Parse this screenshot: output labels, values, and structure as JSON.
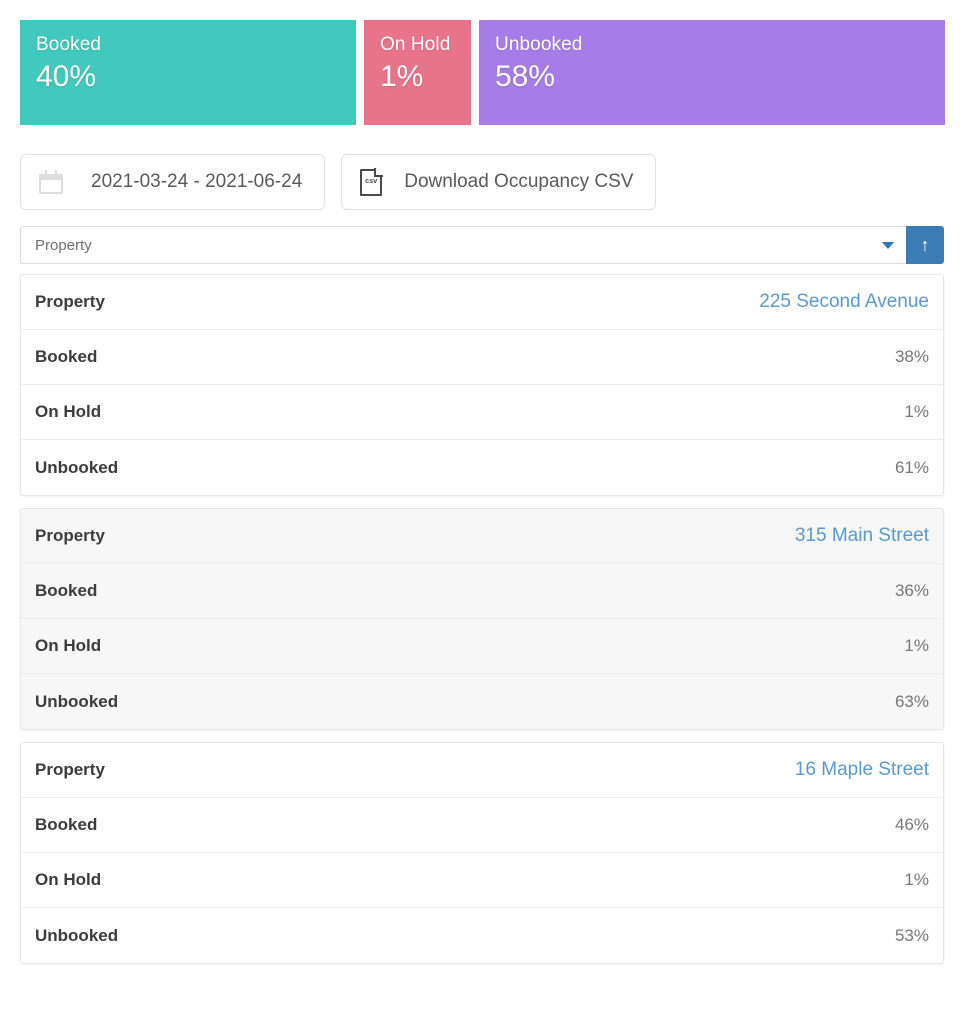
{
  "summary": {
    "segments": [
      {
        "label": "Booked",
        "value": "40%",
        "pct": 40,
        "color": "#41c9bd"
      },
      {
        "label": "On Hold",
        "value": "1%",
        "pct": 11,
        "color": "#e8748b"
      },
      {
        "label": "Unbooked",
        "value": "58%",
        "pct": 49,
        "color": "#a77ce8"
      }
    ]
  },
  "toolbar": {
    "date_range": "2021-03-24 - 2021-06-24",
    "calendar_icon": "calendar-icon",
    "download_label": "Download Occupancy CSV",
    "csv_icon": "csv-file-icon",
    "csv_icon_text": "csv"
  },
  "filter": {
    "placeholder": "Property",
    "selected": "Property",
    "chevron_icon": "chevron-down-icon",
    "submit_icon": "↑",
    "submit_color": "#3b7cb5"
  },
  "row_labels": {
    "property": "Property",
    "booked": "Booked",
    "on_hold": "On Hold",
    "unbooked": "Unbooked"
  },
  "properties": [
    {
      "property_label": "Property",
      "name": "225 Second Avenue",
      "booked_label": "Booked",
      "booked": "38%",
      "on_hold_label": "On Hold",
      "on_hold": "1%",
      "unbooked_label": "Unbooked",
      "unbooked": "61%"
    },
    {
      "property_label": "Property",
      "name": "315 Main Street",
      "booked_label": "Booked",
      "booked": "36%",
      "on_hold_label": "On Hold",
      "on_hold": "1%",
      "unbooked_label": "Unbooked",
      "unbooked": "63%"
    },
    {
      "property_label": "Property",
      "name": "16 Maple Street",
      "booked_label": "Booked",
      "booked": "46%",
      "on_hold_label": "On Hold",
      "on_hold": "1%",
      "unbooked_label": "Unbooked",
      "unbooked": "53%"
    }
  ],
  "colors": {
    "booked": "#41c9bd",
    "on_hold": "#e8748b",
    "unbooked": "#a77ce8",
    "link": "#5b99d4",
    "accent": "#3b7cb5"
  }
}
